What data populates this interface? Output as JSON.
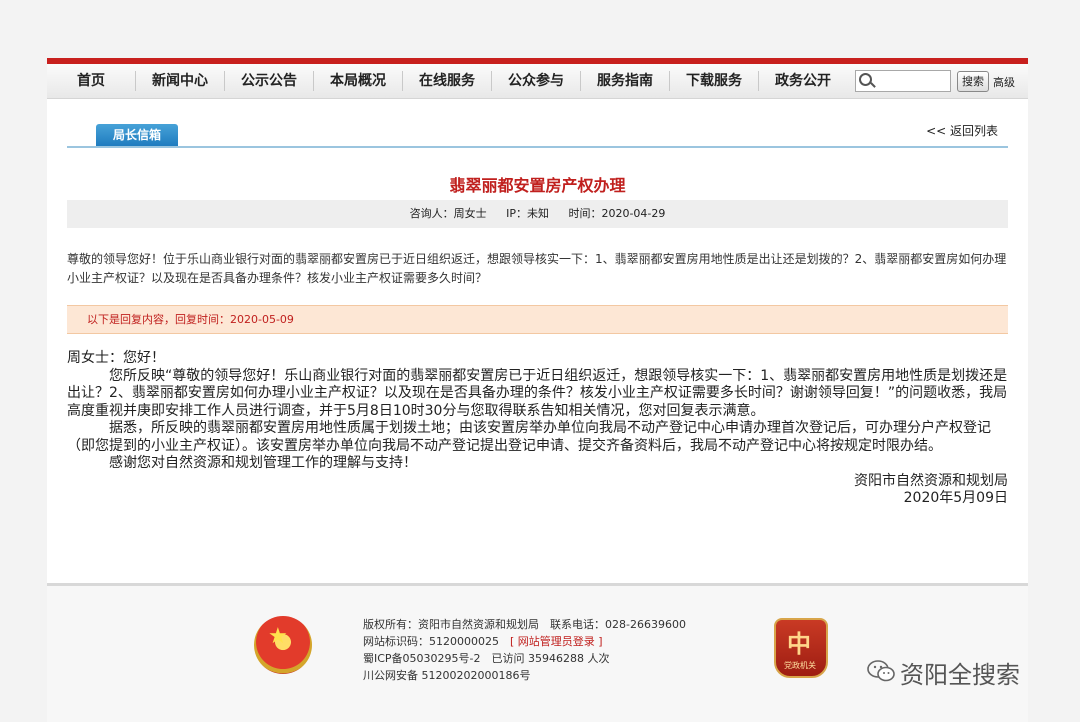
{
  "nav": {
    "items": [
      "首页",
      "新闻中心",
      "公示公告",
      "本局概况",
      "在线服务",
      "公众参与",
      "服务指南",
      "下载服务",
      "政务公开"
    ],
    "search_placeholder": "",
    "search_button": "搜索",
    "advanced": "高级"
  },
  "section": {
    "tab": "局长信箱",
    "back": "<< 返回列表"
  },
  "article": {
    "title": "翡翠丽都安置房产权办理",
    "asker": "咨询人：周女士",
    "ip": "IP：未知",
    "time": "时间：2020-04-29",
    "question": "尊敬的领导您好！位于乐山商业银行对面的翡翠丽都安置房已于近日组织返迁，想跟领导核实一下：1、翡翠丽都安置房用地性质是出让还是划拨的？2、翡翠丽都安置房如何办理小业主产权证？以及现在是否具备办理条件？核发小业主产权证需要多久时间？"
  },
  "reply": {
    "header": "以下是回复内容，回复时间：2020-05-09",
    "greeting": "周女士：您好！",
    "para1": "　　　您所反映“尊敬的领导您好！乐山商业银行对面的翡翠丽都安置房已于近日组织返迁，想跟领导核实一下：1、翡翠丽都安置房用地性质是划拨还是出让？2、翡翠丽都安置房如何办理小业主产权证？以及现在是否具备办理的条件？核发小业主产权证需要多长时间？谢谢领导回复！”的问题收悉，我局高度重视并庚即安排工作人员进行调查，并于5月8日10时30分与您取得联系告知相关情况，您对回复表示满意。",
    "para2": "　　　据悉，所反映的翡翠丽都安置房用地性质属于划拨土地；由该安置房举办单位向我局不动产登记中心申请办理首次登记后，可办理分户产权登记（即您提到的小业主产权证）。该安置房举办单位向我局不动产登记提出登记申请、提交齐备资料后，我局不动产登记中心将按规定时限办结。",
    "para3": "　　　感谢您对自然资源和规划管理工作的理解与支持！",
    "signer": "资阳市自然资源和规划局",
    "date": "2020年5月09日"
  },
  "footer": {
    "copyright": "版权所有：资阳市自然资源和规划局　联系电话：028-26639600",
    "site_id_prefix": "网站标识码：5120000025　",
    "admin_login": "[ 网站管理员登录 ]",
    "icp": "蜀ICP备05030295号-2　已访问 35946288 人次",
    "police": "川公网安备 51200202000186号",
    "party_label": "党政机关",
    "party_glyph": "中"
  },
  "watermark": "资阳全搜索"
}
